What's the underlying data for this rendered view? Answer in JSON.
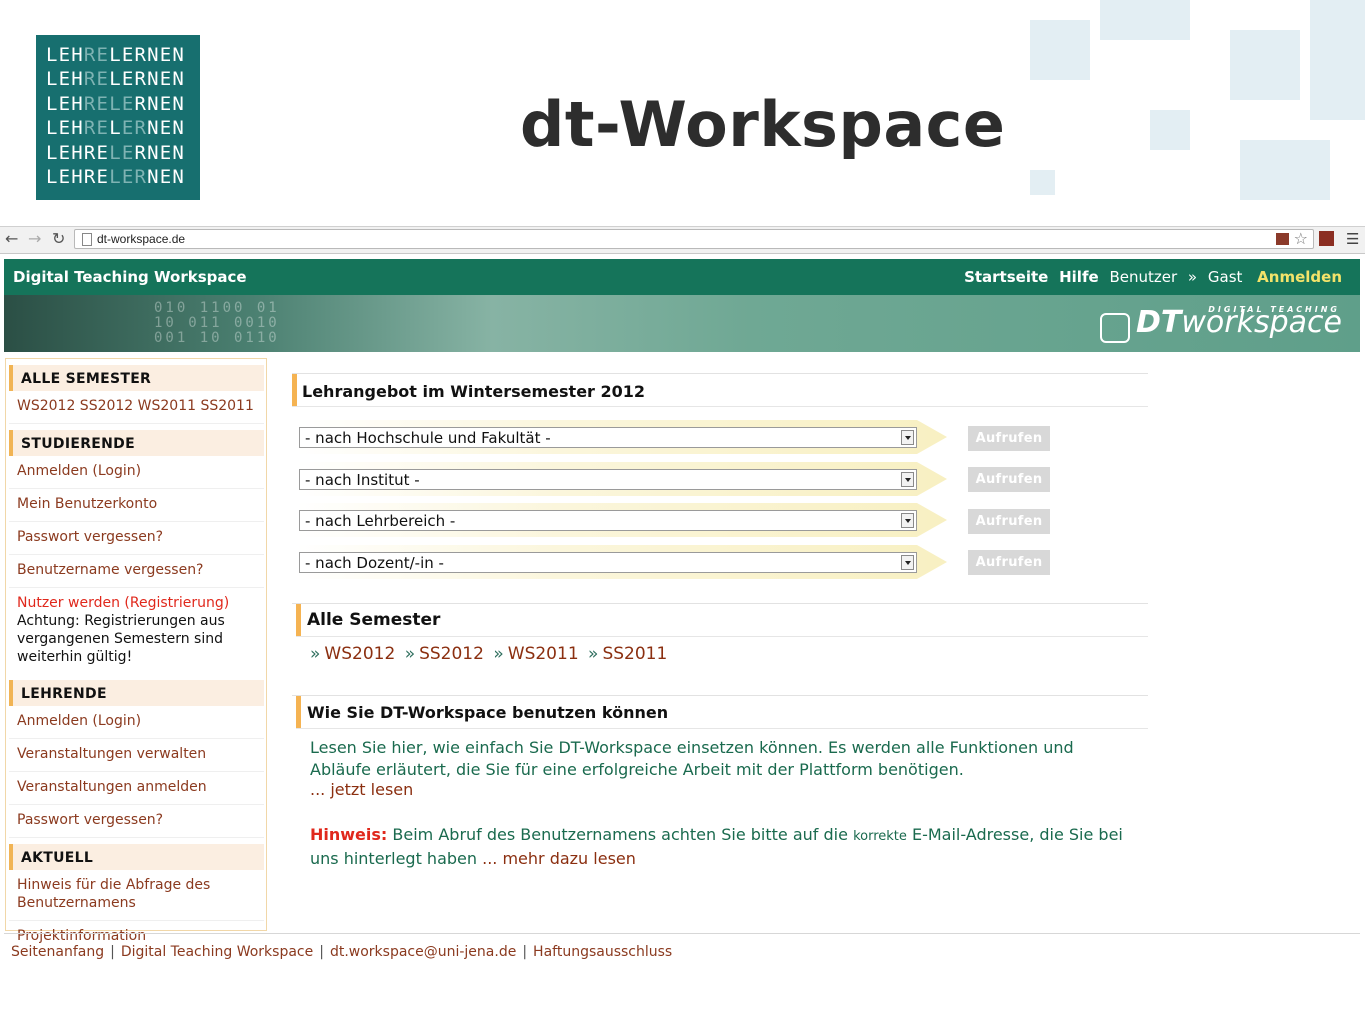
{
  "slide": {
    "title": "dt-Workspace",
    "logo_lines": [
      "LEHRELERNEN",
      "LEHRELERNEN",
      "LEHRELERNEN",
      "LEHRELERNEN",
      "LEHRELERNEN",
      "LEHRELERNEN"
    ]
  },
  "browser": {
    "url": "dt-workspace.de",
    "back_icon": "arrow-left",
    "forward_icon": "arrow-right",
    "reload_icon": "reload",
    "star_icon": "star-outline",
    "menu_icon": "hamburger"
  },
  "header": {
    "title": "Digital Teaching Workspace",
    "nav": {
      "home": "Startseite",
      "help": "Hilfe",
      "user_label": "Benutzer",
      "user_sep": "»",
      "user_value": "Gast",
      "login": "Anmelden"
    },
    "banner_logo_small": "DIGITAL TEACHING",
    "banner_logo_dt": "DT",
    "banner_logo_workspace": "workspace",
    "colors": {
      "header_green": "#15745a",
      "accent_orange": "#f5b352",
      "link_brown": "#8b2f10",
      "highlight_yellow": "#f3e36a"
    }
  },
  "sidebar": {
    "sections": [
      {
        "heading": "ALLE SEMESTER",
        "items": [
          {
            "label": "WS2012 SS2012 WS2011 SS2011"
          }
        ]
      },
      {
        "heading": "STUDIERENDE",
        "items": [
          {
            "label": "Anmelden (Login)"
          },
          {
            "label": "Mein Benutzerkonto"
          },
          {
            "label": "Passwort vergessen?"
          },
          {
            "label": "Benutzername vergessen?"
          },
          {
            "label": "Nutzer werden (Registrierung)"
          }
        ],
        "note": "Achtung: Registrierungen aus vergangenen Semestern sind weiterhin gültig!"
      },
      {
        "heading": "LEHRENDE",
        "items": [
          {
            "label": "Anmelden (Login)"
          },
          {
            "label": "Veranstaltungen verwalten"
          },
          {
            "label": "Veranstaltungen anmelden"
          },
          {
            "label": "Passwort vergessen?"
          }
        ]
      },
      {
        "heading": "AKTUELL",
        "items": [
          {
            "label": "Hinweis für die Abfrage des Benutzernamens"
          },
          {
            "label": "Projektinformation"
          }
        ]
      }
    ]
  },
  "main": {
    "offer_title": "Lehrangebot im Wintersemester 2012",
    "selects": [
      {
        "value": "- nach Hochschule und Fakultät -",
        "button": "Aufrufen"
      },
      {
        "value": "- nach Institut -",
        "button": "Aufrufen"
      },
      {
        "value": "- nach Lehrbereich -",
        "button": "Aufrufen"
      },
      {
        "value": "- nach Dozent/-in -",
        "button": "Aufrufen"
      }
    ],
    "semesters_title": "Alle Semester",
    "semester_sep": "»",
    "semesters": [
      "WS2012",
      "SS2012",
      "WS2011",
      "SS2011"
    ],
    "howto_title": "Wie Sie DT-Workspace benutzen können",
    "howto_text": "Lesen Sie hier, wie einfach Sie DT-Workspace einsetzen können. Es werden alle Funktionen und Abläufe erläutert, die Sie für eine erfolgreiche Arbeit mit der Plattform benötigen.",
    "howto_link": "... jetzt lesen",
    "hint_label": "Hinweis:",
    "hint_text_1": "Beim Abruf des Benutzernamens achten Sie bitte auf die",
    "hint_small": "korrekte",
    "hint_text_2": "E-Mail-Adresse, die Sie bei uns hinterlegt haben",
    "hint_link": "... mehr dazu lesen"
  },
  "footer": {
    "separator": "|",
    "links": [
      "Seitenanfang",
      "Digital Teaching Workspace",
      "dt.workspace@uni-jena.de",
      "Haftungsausschluss"
    ]
  }
}
